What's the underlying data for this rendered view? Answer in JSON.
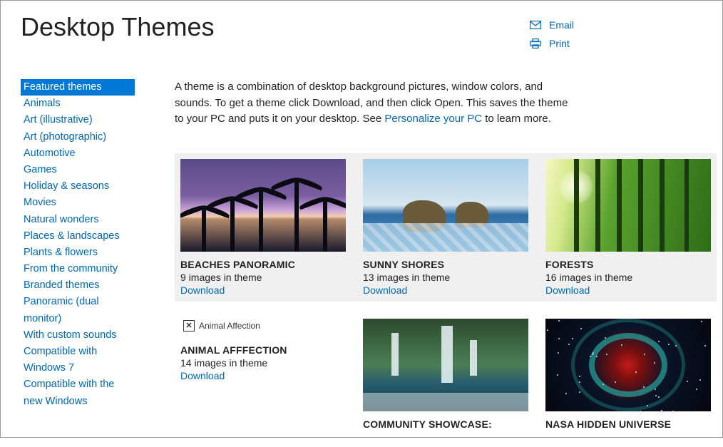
{
  "header": {
    "title": "Desktop Themes",
    "actions": {
      "email": "Email",
      "print": "Print"
    }
  },
  "sidebar": {
    "items": [
      {
        "label": "Featured themes",
        "selected": true
      },
      {
        "label": "Animals"
      },
      {
        "label": "Art (illustrative)"
      },
      {
        "label": "Art (photographic)"
      },
      {
        "label": "Automotive"
      },
      {
        "label": "Games"
      },
      {
        "label": "Holiday & seasons"
      },
      {
        "label": "Movies"
      },
      {
        "label": "Natural wonders"
      },
      {
        "label": "Places & landscapes"
      },
      {
        "label": "Plants & flowers"
      },
      {
        "label": "From the community"
      },
      {
        "label": "Branded themes"
      },
      {
        "label": "Panoramic (dual monitor)"
      },
      {
        "label": "With custom sounds"
      },
      {
        "label": "Compatible with Windows 7"
      },
      {
        "label": "Compatible with the new Windows"
      }
    ]
  },
  "intro": {
    "text_before": "A theme is a combination of desktop background pictures, window colors, and sounds. To get a theme click Download, and then click Open. This saves the theme to your PC and puts it on your desktop. See ",
    "link_text": "Personalize your PC",
    "text_after": " to learn more."
  },
  "download_label": "Download",
  "row1": [
    {
      "title": "BEACHES PANORAMIC",
      "count": "9 images in theme",
      "thumb": "beach"
    },
    {
      "title": "SUNNY SHORES",
      "count": "13 images in theme",
      "thumb": "shores"
    },
    {
      "title": "FORESTS",
      "count": "16 images in theme",
      "thumb": "forest"
    }
  ],
  "row2": [
    {
      "title": "ANIMAL AFFFECTION",
      "count": "14 images in theme",
      "thumb": "broken",
      "alt": "Animal Affection"
    },
    {
      "title": "COMMUNITY SHOWCASE:",
      "count": "",
      "thumb": "waterfall"
    },
    {
      "title": "NASA HIDDEN UNIVERSE",
      "count": "",
      "thumb": "nebula"
    }
  ]
}
